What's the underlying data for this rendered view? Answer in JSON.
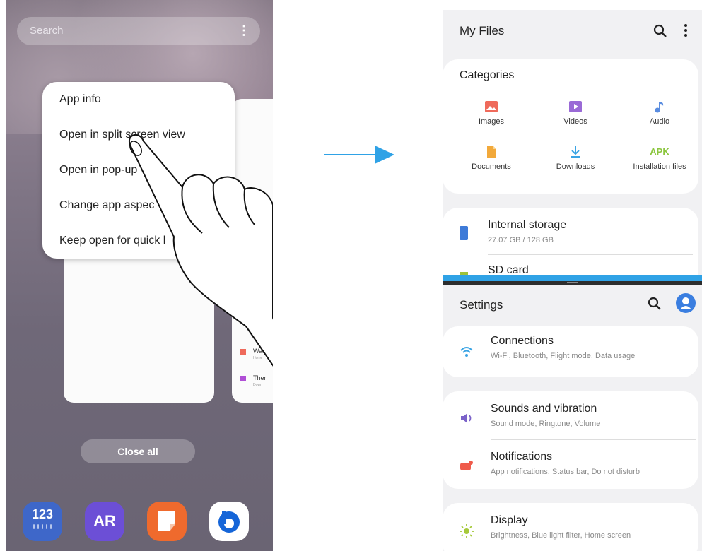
{
  "left_phone": {
    "search_placeholder": "Search",
    "context_menu": [
      "App info",
      "Open in split screen view",
      "Open in pop-up",
      "Change app aspec",
      "Keep open for quick l"
    ],
    "recent_right_card": {
      "rows": [
        {
          "title": "Wall",
          "sub": "Home"
        },
        {
          "title": "Ther",
          "sub": "Down"
        }
      ]
    },
    "close_all_label": "Close all",
    "dock": {
      "keyboard_label": "123",
      "ar_label": "AR"
    }
  },
  "right_phone": {
    "my_files": {
      "title": "My Files",
      "categories_title": "Categories",
      "categories": [
        {
          "label": "Images",
          "icon": "image-icon"
        },
        {
          "label": "Videos",
          "icon": "video-icon"
        },
        {
          "label": "Audio",
          "icon": "music-note-icon"
        },
        {
          "label": "Documents",
          "icon": "document-icon"
        },
        {
          "label": "Downloads",
          "icon": "download-icon"
        },
        {
          "label": "Installation files",
          "icon": "apk-icon",
          "icon_text": "APK"
        }
      ],
      "storage": [
        {
          "title": "Internal storage",
          "sub": "27.07 GB / 128 GB"
        },
        {
          "title": "SD card"
        }
      ]
    },
    "settings": {
      "title": "Settings",
      "items": [
        {
          "title": "Connections",
          "sub": "Wi-Fi, Bluetooth, Flight mode, Data usage",
          "icon": "wifi-icon"
        },
        {
          "title": "Sounds and vibration",
          "sub": "Sound mode, Ringtone, Volume",
          "icon": "speaker-icon"
        },
        {
          "title": "Notifications",
          "sub": "App notifications, Status bar, Do not disturb",
          "icon": "notification-icon"
        },
        {
          "title": "Display",
          "sub": "Brightness, Blue light filter, Home screen",
          "icon": "sun-icon"
        }
      ]
    }
  },
  "colors": {
    "accent_blue": "#2fa2e6",
    "wifi": "#3aa4e4",
    "sound": "#7b62c9",
    "notification": "#ef5b4b",
    "display": "#a6c93a",
    "images": "#ef6a5b",
    "videos": "#9a6ad6",
    "audio": "#5a8de0",
    "documents": "#f2a93b",
    "downloads": "#3aa4e4",
    "apk": "#8cc63f"
  }
}
